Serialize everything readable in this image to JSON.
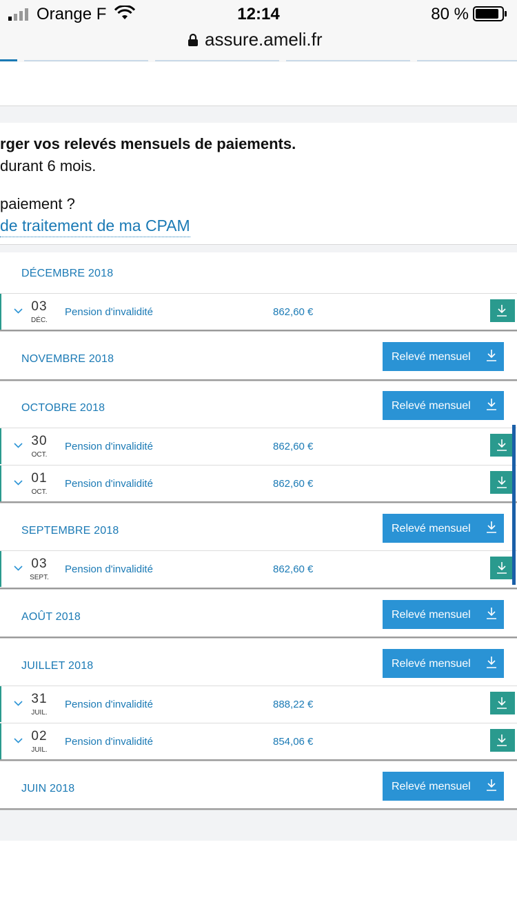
{
  "status_bar": {
    "carrier": "Orange F",
    "time": "12:14",
    "battery": "80 %"
  },
  "browser": {
    "url": "assure.ameli.fr"
  },
  "intro": {
    "title": "rger vos relevés mensuels de paiements.",
    "subtitle": "durant 6 mois.",
    "question": "paiement ?",
    "link": "de traitement de ma CPAM"
  },
  "releve_label": "Relevé mensuel",
  "months": [
    {
      "label": "DÉCEMBRE 2018",
      "releve": false,
      "payments": [
        {
          "day": "03",
          "month": "DÉC.",
          "label": "Pension d'invalidité",
          "amount": "862,60 €"
        }
      ]
    },
    {
      "label": "NOVEMBRE 2018",
      "releve": true,
      "payments": []
    },
    {
      "label": "OCTOBRE 2018",
      "releve": true,
      "payments": [
        {
          "day": "30",
          "month": "OCT.",
          "label": "Pension d'invalidité",
          "amount": "862,60 €"
        },
        {
          "day": "01",
          "month": "OCT.",
          "label": "Pension d'invalidité",
          "amount": "862,60 €"
        }
      ]
    },
    {
      "label": "SEPTEMBRE 2018",
      "releve": true,
      "payments": [
        {
          "day": "03",
          "month": "SEPT.",
          "label": "Pension d'invalidité",
          "amount": "862,60 €"
        }
      ]
    },
    {
      "label": "AOÛT 2018",
      "releve": true,
      "payments": []
    },
    {
      "label": "JUILLET 2018",
      "releve": true,
      "payments": [
        {
          "day": "31",
          "month": "JUIL.",
          "label": "Pension d'invalidité",
          "amount": "888,22 €"
        },
        {
          "day": "02",
          "month": "JUIL.",
          "label": "Pension d'invalidité",
          "amount": "854,06 €"
        }
      ]
    },
    {
      "label": "JUIN 2018",
      "releve": true,
      "payments": []
    }
  ],
  "colors": {
    "link_blue": "#1b7ab5",
    "button_blue": "#2a93d5",
    "teal": "#2a9a8e"
  }
}
